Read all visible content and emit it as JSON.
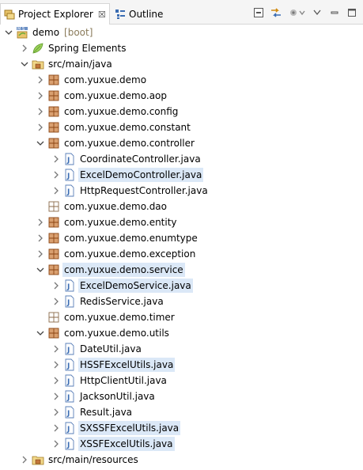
{
  "tabs": {
    "project_explorer": "Project Explorer",
    "close": "☒",
    "outline": "Outline"
  },
  "toolbar_icons": [
    "collapse-all-icon",
    "link-with-editor-icon",
    "focus-icon",
    "view-menu-icon",
    "minimize-icon",
    "maximize-icon"
  ],
  "tree": {
    "rows": [
      {
        "label": "demo",
        "annotation": "[boot]",
        "icon": "spring-project-icon",
        "arrow": "down",
        "selected": false
      },
      {
        "label": "Spring Elements",
        "icon": "spring-leaf-icon",
        "arrow": "right",
        "selected": false
      },
      {
        "label": "src/main/java",
        "icon": "source-folder-icon",
        "arrow": "down",
        "selected": false
      },
      {
        "label": "com.yuxue.demo",
        "icon": "package-icon",
        "arrow": "right",
        "selected": false
      },
      {
        "label": "com.yuxue.demo.aop",
        "icon": "package-icon",
        "arrow": "right",
        "selected": false
      },
      {
        "label": "com.yuxue.demo.config",
        "icon": "package-icon",
        "arrow": "right",
        "selected": false
      },
      {
        "label": "com.yuxue.demo.constant",
        "icon": "package-icon",
        "arrow": "right",
        "selected": false
      },
      {
        "label": "com.yuxue.demo.controller",
        "icon": "package-icon",
        "arrow": "down",
        "selected": false
      },
      {
        "label": "CoordinateController.java",
        "icon": "java-file-icon",
        "arrow": "right",
        "selected": false
      },
      {
        "label": "ExcelDemoController.java",
        "icon": "java-file-icon",
        "arrow": "right",
        "selected": true
      },
      {
        "label": "HttpRequestController.java",
        "icon": "java-file-icon",
        "arrow": "right",
        "selected": false
      },
      {
        "label": "com.yuxue.demo.dao",
        "icon": "empty-package-icon",
        "arrow": "none",
        "selected": false
      },
      {
        "label": "com.yuxue.demo.entity",
        "icon": "package-icon",
        "arrow": "right",
        "selected": false
      },
      {
        "label": "com.yuxue.demo.enumtype",
        "icon": "package-icon",
        "arrow": "right",
        "selected": false
      },
      {
        "label": "com.yuxue.demo.exception",
        "icon": "package-icon",
        "arrow": "right",
        "selected": false
      },
      {
        "label": "com.yuxue.demo.service",
        "icon": "package-icon",
        "arrow": "down",
        "selected": true
      },
      {
        "label": "ExcelDemoService.java",
        "icon": "java-file-icon",
        "arrow": "right",
        "selected": true
      },
      {
        "label": "RedisService.java",
        "icon": "java-file-icon",
        "arrow": "right",
        "selected": false
      },
      {
        "label": "com.yuxue.demo.timer",
        "icon": "empty-package-icon",
        "arrow": "none",
        "selected": false
      },
      {
        "label": "com.yuxue.demo.utils",
        "icon": "package-icon",
        "arrow": "down",
        "selected": false
      },
      {
        "label": "DateUtil.java",
        "icon": "java-file-icon",
        "arrow": "right",
        "selected": false
      },
      {
        "label": "HSSFExcelUtils.java",
        "icon": "java-file-icon",
        "arrow": "right",
        "selected": true
      },
      {
        "label": "HttpClientUtil.java",
        "icon": "java-file-icon",
        "arrow": "right",
        "selected": false
      },
      {
        "label": "JacksonUtil.java",
        "icon": "java-file-icon",
        "arrow": "right",
        "selected": false
      },
      {
        "label": "Result.java",
        "icon": "java-file-icon",
        "arrow": "right",
        "selected": false
      },
      {
        "label": "SXSSFExcelUtils.java",
        "icon": "java-file-icon",
        "arrow": "right",
        "selected": true
      },
      {
        "label": "XSSFExcelUtils.java",
        "icon": "java-file-icon",
        "arrow": "right",
        "selected": true
      },
      {
        "label": "src/main/resources",
        "icon": "source-folder-icon",
        "arrow": "right",
        "selected": false
      }
    ]
  },
  "colors": {
    "selection": "#dbe8f7",
    "annotation": "#8a7b5a",
    "package_brown": "#a0522d",
    "java_blue": "#3b6db3",
    "spring_green": "#6aab3b"
  }
}
